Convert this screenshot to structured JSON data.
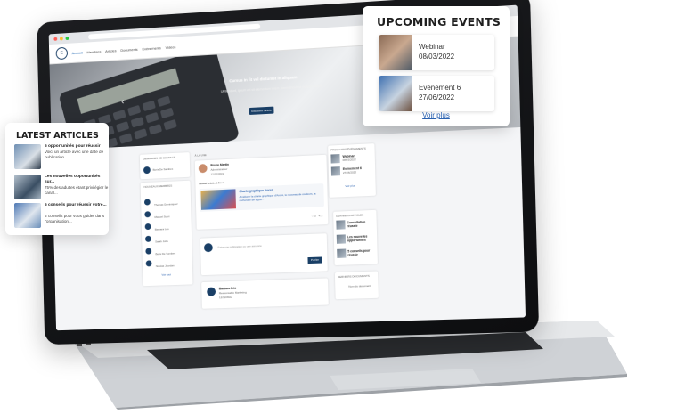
{
  "screen": {
    "nav": {
      "logo": "E",
      "links": [
        "Accueil",
        "Membres",
        "Articles",
        "Documents",
        "Evénements",
        "Vidéos"
      ]
    },
    "hero": {
      "title": "Cursus in fit vel dictumst in aliquam",
      "subtitle": "Ut tincidunt, ipsum vel sit elementum lorem, lorem tincidunt molestie lorem.",
      "button": "Découvrir l'article"
    },
    "left_panel": {
      "header": "DEMANDES DE CONTACT",
      "contact": "Boris De Sambes",
      "members_header": "NOUVEAUX MEMBRES",
      "members": [
        "Thomas Dominiquez",
        "Manuel Suuri",
        "Barbara Léo",
        "Sarah Jobs",
        "Boris De Sambes",
        "Nicolas Jourdan"
      ],
      "see_all": "Voir tout"
    },
    "feed": {
      "header": "À LA UNE",
      "post_author": "Bruno Martin",
      "post_role": "Administrateur",
      "post_date": "12/12/2022",
      "post_text": "Nouvel article, à lire !",
      "link_title": "Charte graphique Ancré",
      "link_desc": "Améliorer la charte graphique d'Ancré, le nouveau de couleurs, la recherche de logos...",
      "composer_placeholder": "Faire une publication ou une annonce",
      "publish": "Publier",
      "second_author": "Barbara Léo",
      "second_role": "Responsable Marketing",
      "second_date": "12/12/2022"
    },
    "right_panel": {
      "events_header": "PROCHAINS ÉVÉNEMENTS",
      "events": [
        {
          "name": "Webinar",
          "date": "08/03/2022"
        },
        {
          "name": "Evénement 6",
          "date": "27/06/2022"
        }
      ],
      "see_more": "Voir plus",
      "articles_header": "DERNIERS ARTICLES",
      "articles": [
        "Consultation réussie",
        "Les nouvelles opportunités",
        "5 conseils pour réussir"
      ],
      "docs_header": "DERNIERS DOCUMENTS",
      "doc": "Nom du document"
    }
  },
  "upcoming_events": {
    "title": "UPCOMING EVENTS",
    "items": [
      {
        "name": "Webinar",
        "date": "08/03/2022"
      },
      {
        "name": "Evénement 6",
        "date": "27/06/2022"
      }
    ],
    "link": "Voir plus"
  },
  "latest_articles": {
    "title": "LATEST ARTICLES",
    "items": [
      {
        "title": "5 opportunités pour réussir",
        "desc": "Voici un article avec une date de publication..."
      },
      {
        "title": "Les nouvelles opportunités sur...",
        "desc": "75% des adultes étant privilégier le canal..."
      },
      {
        "title": "5 conseils pour réussir votre...",
        "desc": "5 conseils pour vous guider dans l'organisation..."
      }
    ]
  },
  "colors": {
    "brand": "#1a3f66",
    "link": "#2b62b0"
  }
}
